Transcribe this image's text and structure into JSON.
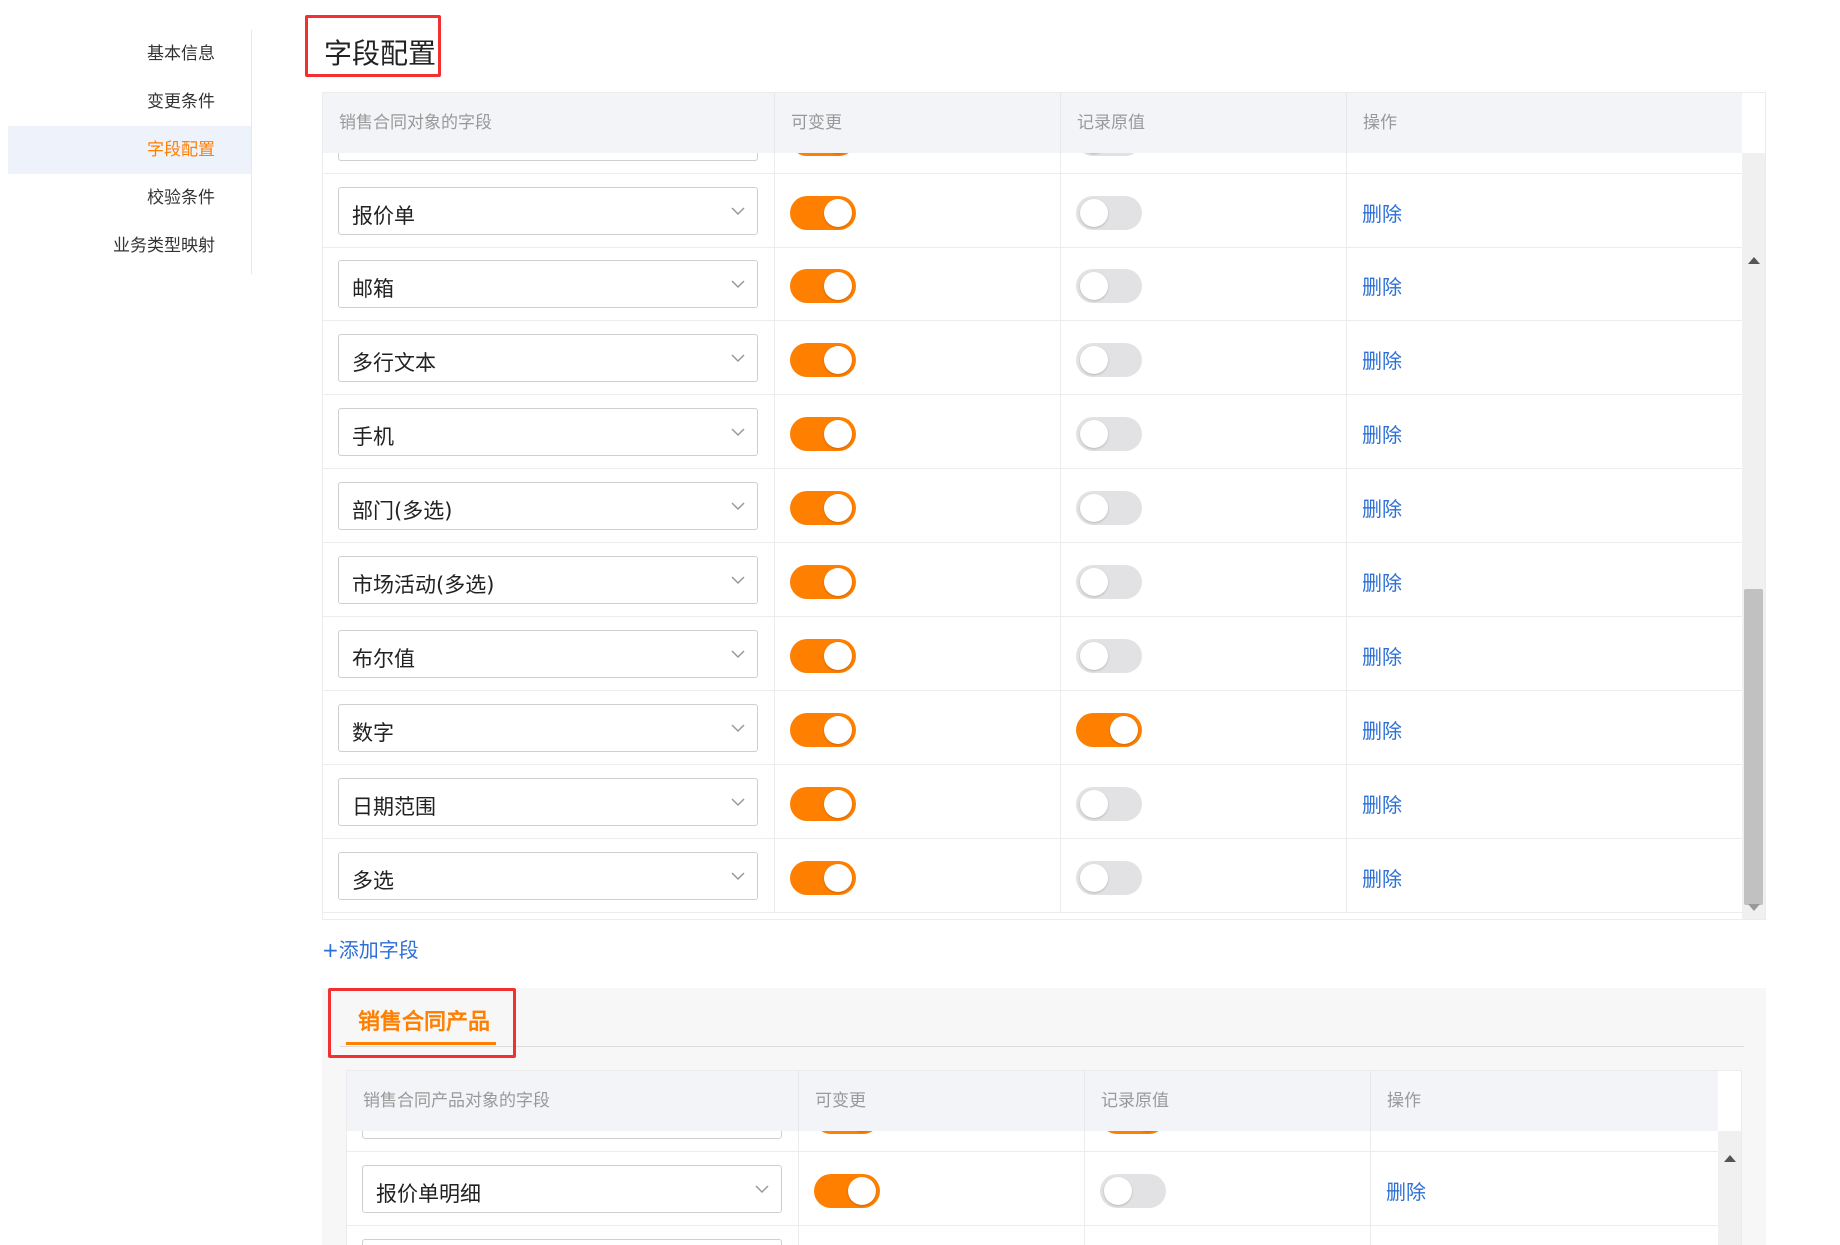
{
  "sidebar": {
    "items": [
      {
        "label": "基本信息",
        "active": false
      },
      {
        "label": "变更条件",
        "active": false
      },
      {
        "label": "字段配置",
        "active": true
      },
      {
        "label": "校验条件",
        "active": false
      },
      {
        "label": "业务类型映射",
        "active": false
      }
    ]
  },
  "section": {
    "title": "字段配置"
  },
  "table1": {
    "headers": [
      "销售合同对象的字段",
      "可变更",
      "记录原值",
      "操作"
    ],
    "rows": [
      {
        "field": "报价单",
        "changeable": true,
        "record_original": false,
        "action": "删除"
      },
      {
        "field": "邮箱",
        "changeable": true,
        "record_original": false,
        "action": "删除"
      },
      {
        "field": "多行文本",
        "changeable": true,
        "record_original": false,
        "action": "删除"
      },
      {
        "field": "手机",
        "changeable": true,
        "record_original": false,
        "action": "删除"
      },
      {
        "field": "部门(多选)",
        "changeable": true,
        "record_original": false,
        "action": "删除"
      },
      {
        "field": "市场活动(多选)",
        "changeable": true,
        "record_original": false,
        "action": "删除"
      },
      {
        "field": "布尔值",
        "changeable": true,
        "record_original": false,
        "action": "删除"
      },
      {
        "field": "数字",
        "changeable": true,
        "record_original": true,
        "action": "删除"
      },
      {
        "field": "日期范围",
        "changeable": true,
        "record_original": false,
        "action": "删除"
      },
      {
        "field": "多选",
        "changeable": true,
        "record_original": false,
        "action": "删除"
      }
    ]
  },
  "add_field_label": "+添加字段",
  "tab": {
    "label": "销售合同产品"
  },
  "table2": {
    "headers": [
      "销售合同产品对象的字段",
      "可变更",
      "记录原值",
      "操作"
    ],
    "rows": [
      {
        "field": "报价单明细",
        "changeable": true,
        "record_original": false,
        "action": "删除"
      }
    ]
  },
  "colors": {
    "accent": "#ff7f00",
    "link": "#2c6fd6",
    "highlight_border": "#f23030"
  }
}
